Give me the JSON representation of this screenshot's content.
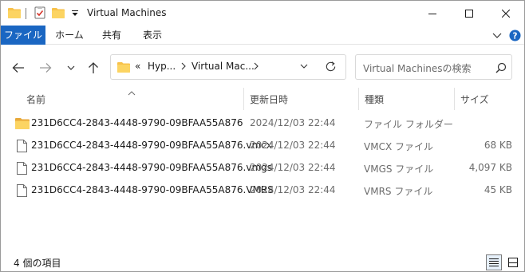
{
  "window": {
    "title": "Virtual Machines",
    "accent": "#1a66c2",
    "folder_color": "#f7c14a"
  },
  "ribbon": {
    "tabs": [
      {
        "label": "ファイル",
        "active": true
      },
      {
        "label": "ホーム"
      },
      {
        "label": "共有"
      },
      {
        "label": "表示"
      }
    ]
  },
  "nav": {
    "address": {
      "overflow": "«",
      "segments": [
        "Hyp...",
        "Virtual Mac..."
      ]
    },
    "search": {
      "placeholder": "Virtual Machinesの検索"
    }
  },
  "columns": {
    "name": "名前",
    "date": "更新日時",
    "type": "種類",
    "size": "サイズ"
  },
  "files": [
    {
      "name": "231D6CC4-2843-4448-9790-09BFAA55A876",
      "date": "2024/12/03 22:44",
      "type": "ファイル フォルダー",
      "size": "",
      "icon": "folder-icon"
    },
    {
      "name": "231D6CC4-2843-4448-9790-09BFAA55A876.vmcx",
      "date": "2024/12/03 22:44",
      "type": "VMCX ファイル",
      "size": "68 KB",
      "icon": "file-icon"
    },
    {
      "name": "231D6CC4-2843-4448-9790-09BFAA55A876.vmgs",
      "date": "2024/12/03 22:44",
      "type": "VMGS ファイル",
      "size": "4,097 KB",
      "icon": "file-icon"
    },
    {
      "name": "231D6CC4-2843-4448-9790-09BFAA55A876.VMRS",
      "date": "2024/12/03 22:44",
      "type": "VMRS ファイル",
      "size": "45 KB",
      "icon": "file-icon"
    }
  ],
  "status": {
    "item_count": "4 個の項目"
  }
}
